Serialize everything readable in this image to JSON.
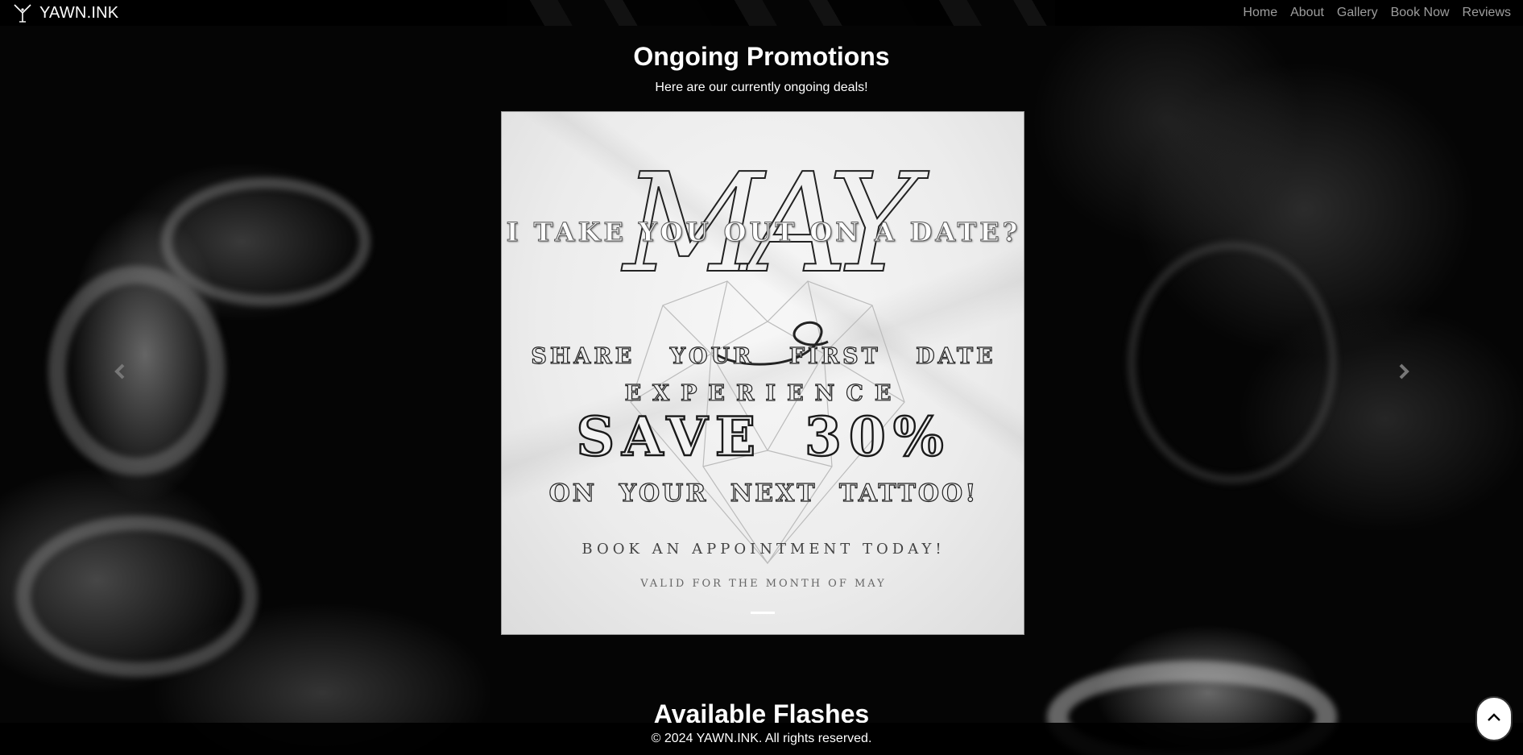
{
  "navbar": {
    "brand_name": "YAWN.INK",
    "links": [
      "Home",
      "About",
      "Gallery",
      "Book Now",
      "Reviews"
    ]
  },
  "promotions": {
    "title": "Ongoing Promotions",
    "subtitle": "Here are our currently ongoing deals!"
  },
  "promo_slide": {
    "headline": "MAY",
    "overlay": "I TAKE YOU OUT ON A DATE?",
    "line1": "SHARE YOUR FIRST DATE",
    "line2": "EXPERIENCE",
    "offer": "SAVE 30%",
    "line3": "ON YOUR NEXT TATTOO!",
    "cta": "BOOK AN APPOINTMENT TODAY!",
    "validity": "VALID FOR THE MONTH OF MAY"
  },
  "carousel": {
    "prev_icon": "chevron-left-icon",
    "next_icon": "chevron-right-icon"
  },
  "flashes": {
    "title": "Available Flashes"
  },
  "footer": {
    "text": "© 2024 YAWN.INK. All rights reserved."
  },
  "scroll_top_icon": "chevron-up-icon",
  "colors": {
    "navbar_bg": "#000000",
    "nav_link": "#9d9d9d",
    "text": "#ffffff"
  }
}
